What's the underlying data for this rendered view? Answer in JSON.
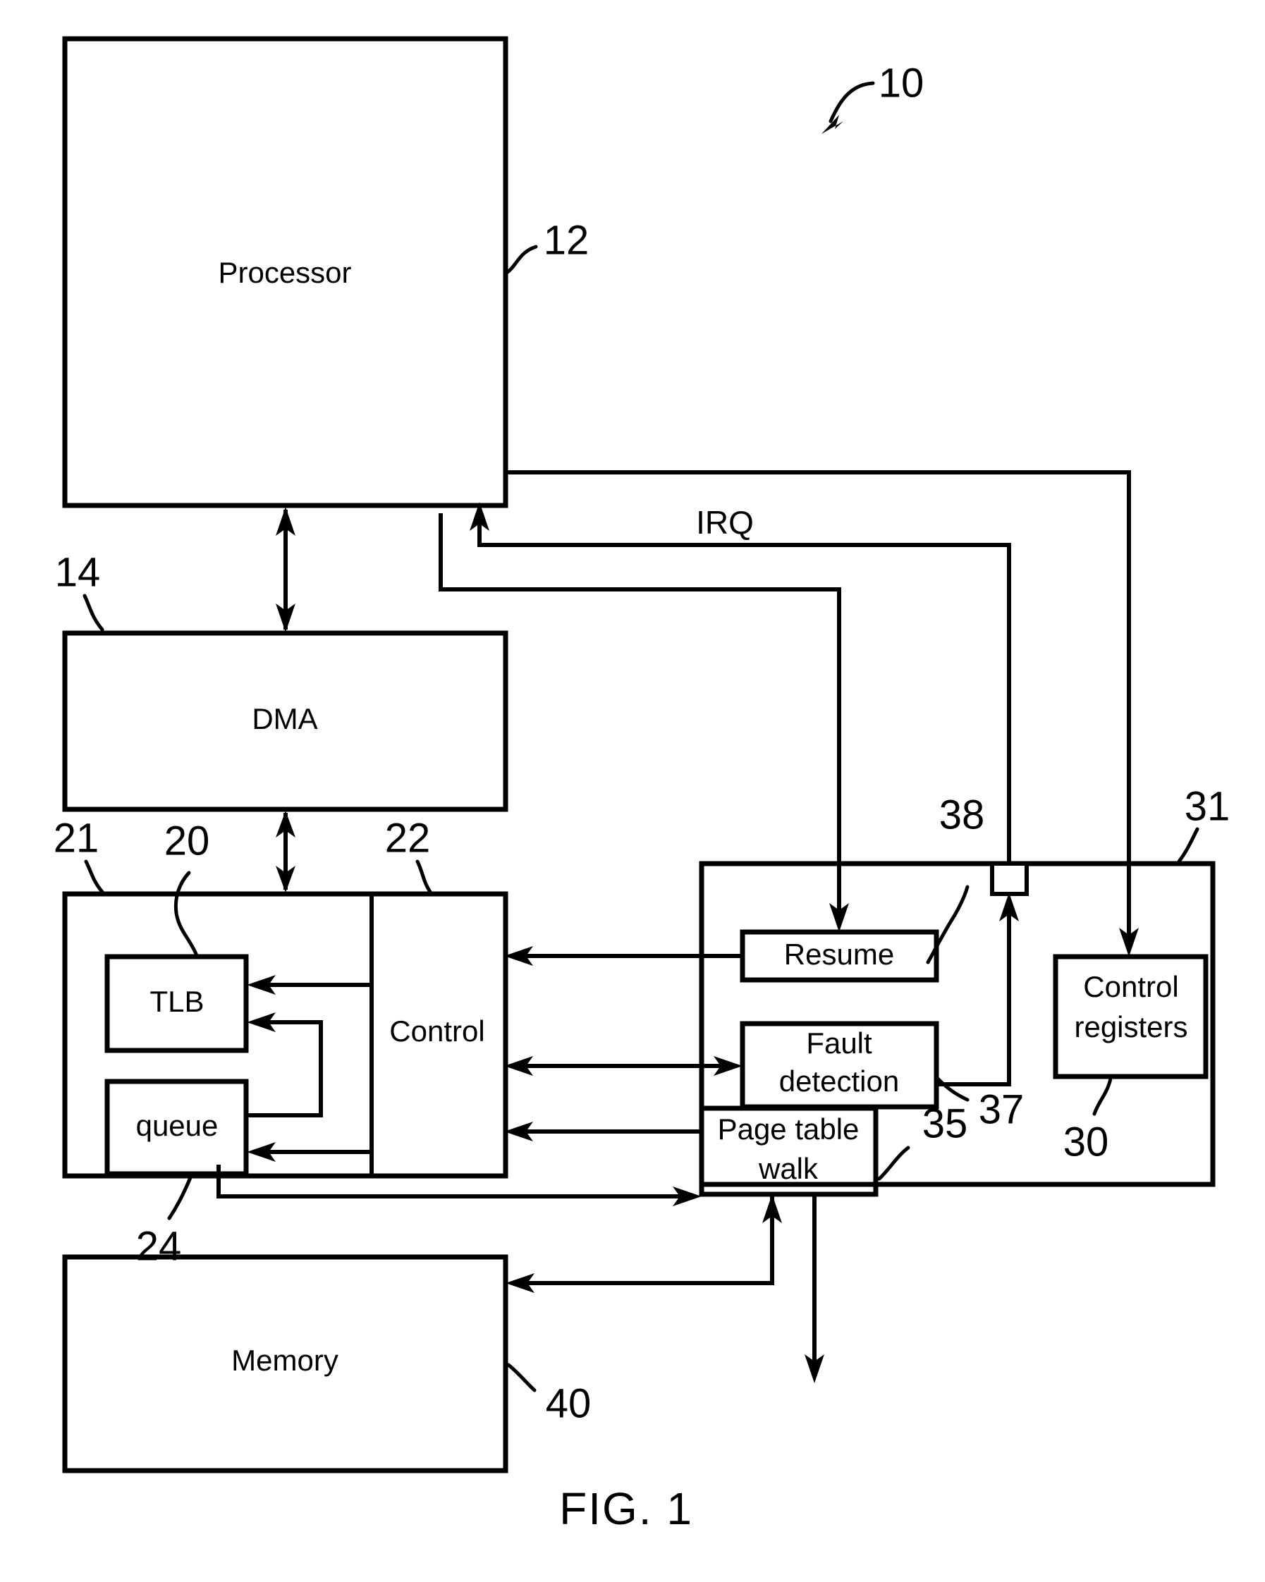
{
  "figure": {
    "caption": "FIG. 1",
    "system_ref": "10"
  },
  "blocks": {
    "processor": {
      "label": "Processor",
      "ref": "12"
    },
    "dma": {
      "label": "DMA",
      "ref": "14"
    },
    "mmu_container": {
      "ref": "21"
    },
    "tlb": {
      "label": "TLB",
      "ref": "20"
    },
    "queue": {
      "label": "queue",
      "ref": "24"
    },
    "control": {
      "label": "Control",
      "ref": "22"
    },
    "right_container": {
      "ref": "31"
    },
    "resume": {
      "label": "Resume",
      "ref": "38"
    },
    "fault_detection": {
      "label": "Fault\ndetection",
      "line1": "Fault",
      "line2": "detection",
      "ref": "37"
    },
    "page_table_walk": {
      "label": "Page table\nwalk",
      "line1": "Page table",
      "line2": "walk",
      "ref": "35"
    },
    "control_registers": {
      "label": "Control\nregisters",
      "line1": "Control",
      "line2": "registers",
      "ref": "30"
    },
    "memory": {
      "label": "Memory",
      "ref": "40"
    }
  },
  "signals": {
    "irq": "IRQ"
  },
  "colors": {
    "stroke": "#000000",
    "background": "#ffffff"
  }
}
